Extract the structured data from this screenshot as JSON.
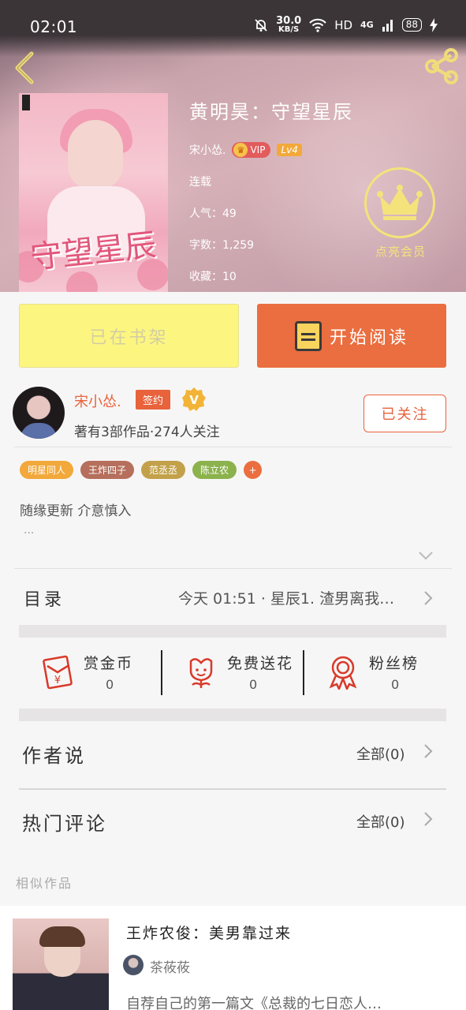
{
  "status_bar": {
    "time": "02:01",
    "net_speed_value": "30.0",
    "net_speed_unit": "KB/S",
    "hd": "HD",
    "network": "4G",
    "battery": "88"
  },
  "book": {
    "title": "黄明昊：守望星辰",
    "author": "宋小怂.",
    "vip_label": "VIP",
    "level_label": "Lv4",
    "status": "连载",
    "popularity": "人气：49",
    "word_count": "字数：1,259",
    "favorites": "收藏：10",
    "cover_art_text": "守望星辰"
  },
  "member": {
    "label": "点亮会员"
  },
  "actions": {
    "shelf_label": "已在书架",
    "read_label": "开始阅读"
  },
  "author_block": {
    "name": "宋小怂.",
    "sign_badge": "签约",
    "v_badge": "V",
    "meta": "著有3部作品·274人关注",
    "follow_label": "已关注"
  },
  "tags": [
    {
      "label": "明星同人",
      "color": "#f2a83a"
    },
    {
      "label": "王炸四子",
      "color": "#b56f5c"
    },
    {
      "label": "范丞丞",
      "color": "#c2a14a"
    },
    {
      "label": "陈立农",
      "color": "#8bb24c"
    }
  ],
  "tag_more": "+",
  "intro": {
    "text": "随缘更新 介意慎入",
    "more": "..."
  },
  "catalog": {
    "label": "目录",
    "latest": "今天 01:51 · 星辰1. 渣男离我…"
  },
  "rewards": [
    {
      "title": "赏金币",
      "count": "0",
      "icon": "red-envelope-icon"
    },
    {
      "title": "免费送花",
      "count": "0",
      "icon": "flower-icon"
    },
    {
      "title": "粉丝榜",
      "count": "0",
      "icon": "medal-icon"
    }
  ],
  "author_says": {
    "label": "作者说",
    "all": "全部(0)"
  },
  "hot_comments": {
    "label": "热门评论",
    "all": "全部(0)"
  },
  "similar": {
    "section_title": "相似作品",
    "items": [
      {
        "title": "王炸农俊：美男靠过来",
        "author": "茶莜莜",
        "desc": "自荐自己的第一篇文《总裁的七日恋人…"
      }
    ]
  },
  "colors": {
    "accent": "#ea6e3f",
    "shelf_button": "#fcf681",
    "member_gold": "#f4e37b"
  }
}
